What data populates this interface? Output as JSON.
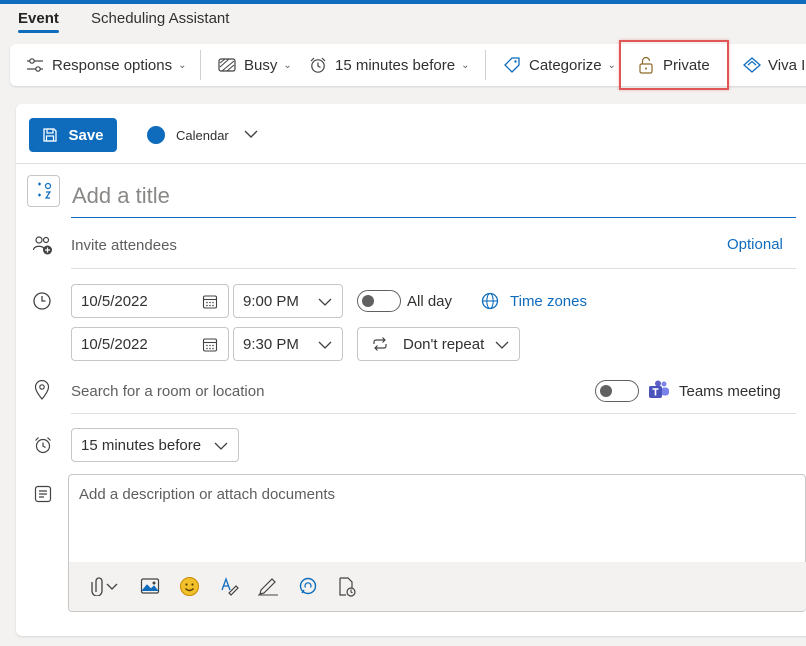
{
  "tabs": [
    {
      "label": "Event",
      "active": true
    },
    {
      "label": "Scheduling Assistant",
      "active": false
    }
  ],
  "ribbon": {
    "response_options": "Response options",
    "busy": "Busy",
    "reminder": "15 minutes before",
    "categorize": "Categorize",
    "private": "Private",
    "viva": "Viva I"
  },
  "header": {
    "save_label": "Save",
    "calendar_label": "Calendar"
  },
  "form": {
    "title_placeholder": "Add a title",
    "invite_label": "Invite attendees",
    "optional_label": "Optional",
    "start_date": "10/5/2022",
    "start_time": "9:00 PM",
    "all_day_label": "All day",
    "time_zones_label": "Time zones",
    "end_date": "10/5/2022",
    "end_time": "9:30 PM",
    "repeat_label": "Don't repeat",
    "location_placeholder": "Search for a room or location",
    "teams_label": "Teams meeting",
    "reminder_value": "15 minutes before",
    "description_placeholder": "Add a description or attach documents"
  },
  "colors": {
    "accent": "#0f6cbd",
    "highlight": "#e05555",
    "teams": "#5b5fc7",
    "emoji": "#f2c02a"
  }
}
